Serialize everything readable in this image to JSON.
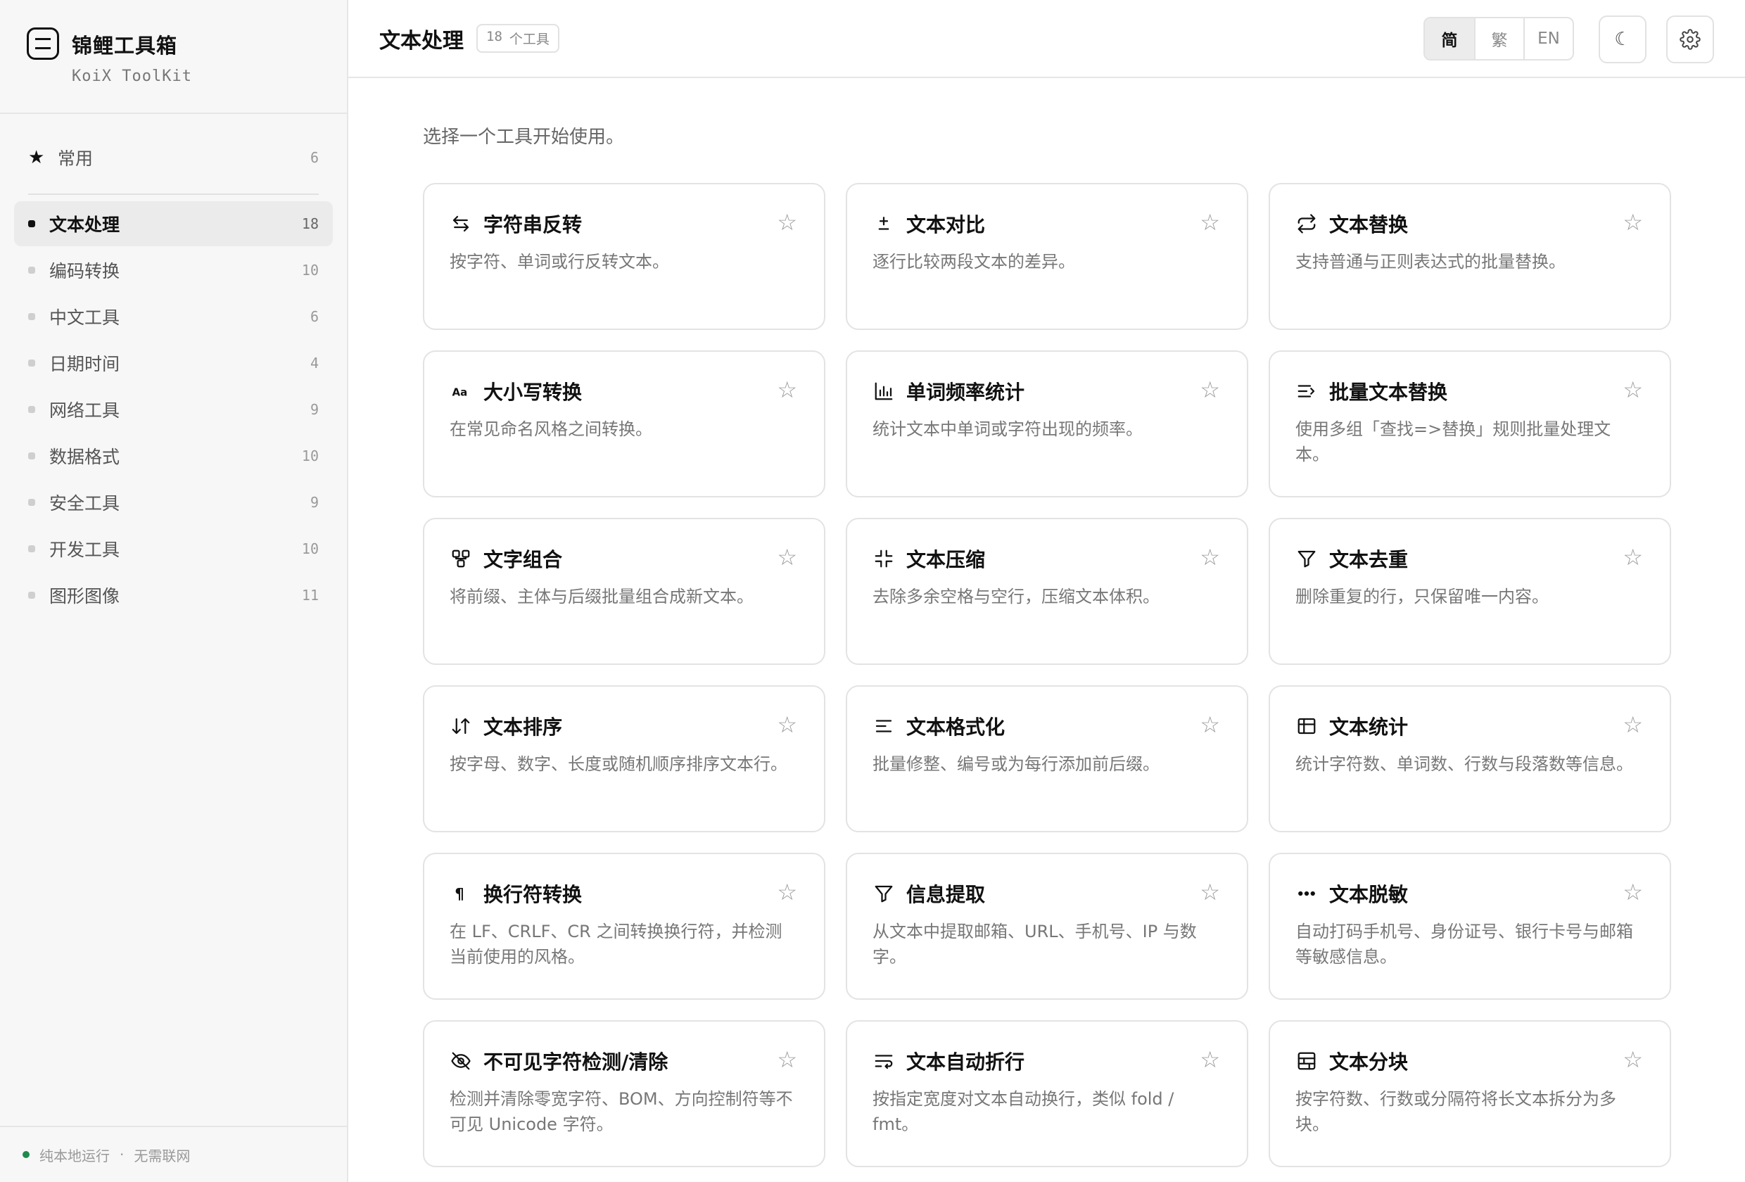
{
  "brand": {
    "name": "锦鲤工具箱",
    "subtitle": "KoiX ToolKit"
  },
  "favorites": {
    "label": "常用",
    "count": "6"
  },
  "nav": [
    {
      "label": "文本处理",
      "count": "18",
      "active": true
    },
    {
      "label": "编码转换",
      "count": "10"
    },
    {
      "label": "中文工具",
      "count": "6"
    },
    {
      "label": "日期时间",
      "count": "4"
    },
    {
      "label": "网络工具",
      "count": "9"
    },
    {
      "label": "数据格式",
      "count": "10"
    },
    {
      "label": "安全工具",
      "count": "9"
    },
    {
      "label": "开发工具",
      "count": "10"
    },
    {
      "label": "图形图像",
      "count": "11"
    }
  ],
  "footer": {
    "status": "纯本地运行",
    "separator": "·",
    "note": "无需联网"
  },
  "header": {
    "title": "文本处理",
    "badge_count": "18",
    "badge_unit": "个工具",
    "languages": [
      "简",
      "繁",
      "EN"
    ],
    "theme_icon": "☾"
  },
  "intro": "选择一个工具开始使用。",
  "tools": [
    {
      "title": "字符串反转",
      "desc": "按字符、单词或行反转文本。",
      "icon": "swap-arrows-icon"
    },
    {
      "title": "文本对比",
      "desc": "逐行比较两段文本的差异。",
      "icon": "plus-minus-icon"
    },
    {
      "title": "文本替换",
      "desc": "支持普通与正则表达式的批量替换。",
      "icon": "repeat-icon"
    },
    {
      "title": "大小写转换",
      "desc": "在常见命名风格之间转换。",
      "icon": "case-icon"
    },
    {
      "title": "单词频率统计",
      "desc": "统计文本中单词或字符出现的频率。",
      "icon": "bar-chart-icon"
    },
    {
      "title": "批量文本替换",
      "desc": "使用多组「查找=>替换」规则批量处理文本。",
      "icon": "list-arrow-icon"
    },
    {
      "title": "文字组合",
      "desc": "将前缀、主体与后缀批量组合成新文本。",
      "icon": "combine-icon"
    },
    {
      "title": "文本压缩",
      "desc": "去除多余空格与空行，压缩文本体积。",
      "icon": "shrink-icon"
    },
    {
      "title": "文本去重",
      "desc": "删除重复的行，只保留唯一内容。",
      "icon": "filter-icon"
    },
    {
      "title": "文本排序",
      "desc": "按字母、数字、长度或随机顺序排序文本行。",
      "icon": "sort-icon"
    },
    {
      "title": "文本格式化",
      "desc": "批量修整、编号或为每行添加前后缀。",
      "icon": "align-icon"
    },
    {
      "title": "文本统计",
      "desc": "统计字符数、单词数、行数与段落数等信息。",
      "icon": "table-icon"
    },
    {
      "title": "换行符转换",
      "desc": "在 LF、CRLF、CR 之间转换换行符，并检测当前使用的风格。",
      "icon": "pilcrow-icon"
    },
    {
      "title": "信息提取",
      "desc": "从文本中提取邮箱、URL、手机号、IP 与数字。",
      "icon": "filter-icon"
    },
    {
      "title": "文本脱敏",
      "desc": "自动打码手机号、身份证号、银行卡号与邮箱等敏感信息。",
      "icon": "ellipsis-icon"
    },
    {
      "title": "不可见字符检测/清除",
      "desc": "检测并清除零宽字符、BOM、方向控制符等不可见 Unicode 字符。",
      "icon": "eye-off-icon"
    },
    {
      "title": "文本自动折行",
      "desc": "按指定宽度对文本自动换行，类似 fold / fmt。",
      "icon": "wrap-icon"
    },
    {
      "title": "文本分块",
      "desc": "按字符数、行数或分隔符将长文本拆分为多块。",
      "icon": "blocks-icon"
    }
  ]
}
